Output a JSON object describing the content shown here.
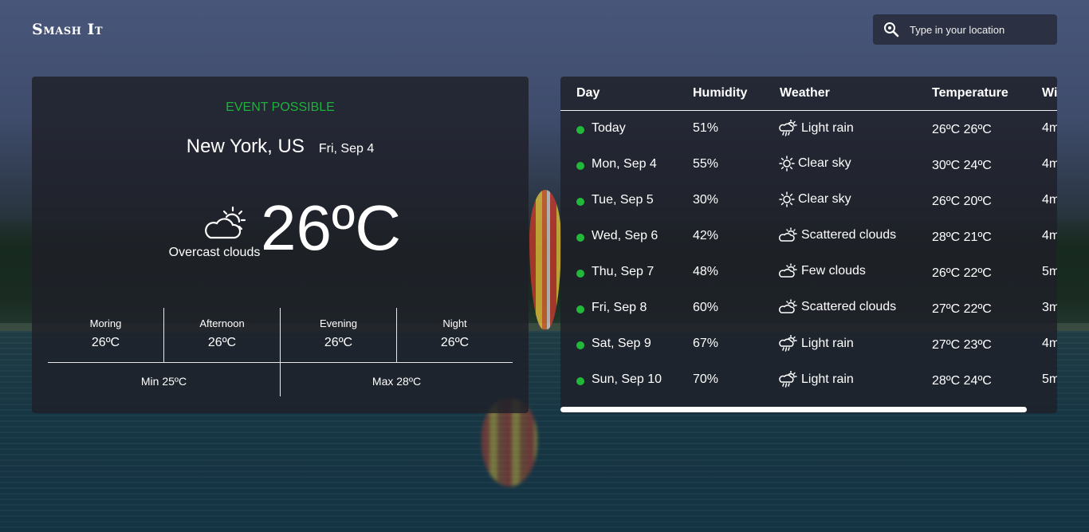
{
  "app": {
    "logo": "Smash It"
  },
  "search": {
    "placeholder": "Type in your location"
  },
  "current": {
    "event_status": "EVENT POSSIBLE",
    "location": "New York, US",
    "date": "Fri, Sep 4",
    "condition": "Overcast clouds",
    "condition_icon": "partly-cloudy-icon",
    "temperature": "26ºC",
    "periods": [
      {
        "name": "Moring",
        "temp": "26ºC"
      },
      {
        "name": "Afternoon",
        "temp": "26ºC"
      },
      {
        "name": "Evening",
        "temp": "26ºC"
      },
      {
        "name": "Night",
        "temp": "26ºC"
      }
    ],
    "min": "Min 25ºC",
    "max": "Max 28ºC"
  },
  "forecast": {
    "headers": [
      "Day",
      "Humidity",
      "Weather",
      "Temperature",
      "Wi"
    ],
    "rows": [
      {
        "day": "Today",
        "humidity": "51%",
        "weather": "Light rain",
        "icon": "rain-icon",
        "temp": "26ºC 26ºC",
        "wind": "4m"
      },
      {
        "day": "Mon, Sep 4",
        "humidity": "55%",
        "weather": "Clear sky",
        "icon": "sun-icon",
        "temp": "30ºC 24ºC",
        "wind": "4m"
      },
      {
        "day": "Tue, Sep 5",
        "humidity": "30%",
        "weather": "Clear sky",
        "icon": "sun-icon",
        "temp": "26ºC 20ºC",
        "wind": "4m"
      },
      {
        "day": "Wed, Sep 6",
        "humidity": "42%",
        "weather": "Scattered clouds",
        "icon": "partly-cloudy-icon",
        "temp": "28ºC 21ºC",
        "wind": "4m"
      },
      {
        "day": "Thu, Sep 7",
        "humidity": "48%",
        "weather": "Few clouds",
        "icon": "partly-cloudy-icon",
        "temp": "26ºC 22ºC",
        "wind": "5m"
      },
      {
        "day": "Fri, Sep 8",
        "humidity": "60%",
        "weather": "Scattered clouds",
        "icon": "partly-cloudy-icon",
        "temp": "27ºC 22ºC",
        "wind": "3m"
      },
      {
        "day": "Sat, Sep 9",
        "humidity": "67%",
        "weather": "Light rain",
        "icon": "rain-icon",
        "temp": "27ºC 23ºC",
        "wind": "4m"
      },
      {
        "day": "Sun, Sep 10",
        "humidity": "70%",
        "weather": "Light rain",
        "icon": "rain-icon",
        "temp": "28ºC 24ºC",
        "wind": "5m"
      }
    ]
  },
  "colors": {
    "event": "#1db33a",
    "status_dot": "#22b83a",
    "card_bg": "#1e2028"
  }
}
